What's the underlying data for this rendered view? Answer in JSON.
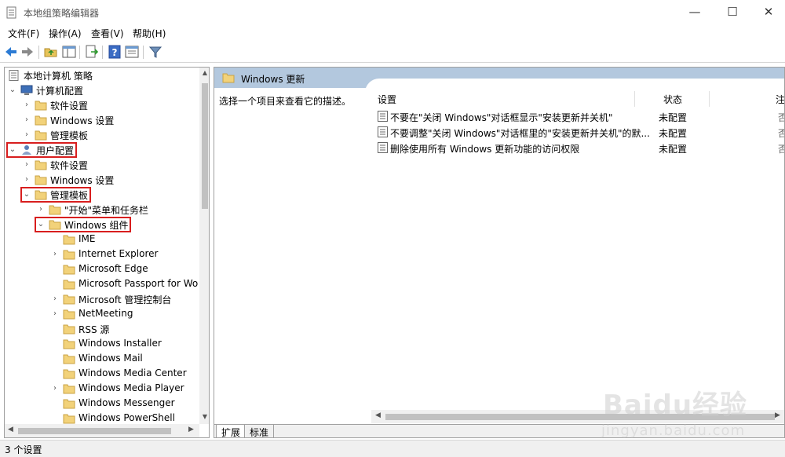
{
  "window": {
    "title": "本地组策略编辑器",
    "min_glyph": "—",
    "max_glyph": "☐",
    "close_glyph": "✕"
  },
  "menu": [
    {
      "label": "文件(F)"
    },
    {
      "label": "操作(A)"
    },
    {
      "label": "查看(V)"
    },
    {
      "label": "帮助(H)"
    }
  ],
  "toolbar": {
    "icons": [
      "back-arrow-icon",
      "forward-arrow-icon",
      "up-folder-icon",
      "show-hide-tree-icon",
      "export-list-icon",
      "help-icon",
      "properties-icon",
      "filter-icon"
    ]
  },
  "tree": {
    "items": [
      {
        "label": "本地计算机 策略",
        "expander": "",
        "icon": "policy-doc-icon"
      },
      {
        "label": "计算机配置",
        "expander": "⌄",
        "icon": "computer-icon"
      },
      {
        "label": "软件设置",
        "expander": "›",
        "icon": "folder-icon"
      },
      {
        "label": "Windows 设置",
        "expander": "›",
        "icon": "folder-icon"
      },
      {
        "label": "管理模板",
        "expander": "›",
        "icon": "folder-icon"
      },
      {
        "label": "用户配置",
        "expander": "⌄",
        "icon": "user-icon",
        "highlight": true
      },
      {
        "label": "软件设置",
        "expander": "›",
        "icon": "folder-icon"
      },
      {
        "label": "Windows 设置",
        "expander": "›",
        "icon": "folder-icon"
      },
      {
        "label": "管理模板",
        "expander": "⌄",
        "icon": "folder-icon",
        "highlight": true
      },
      {
        "label": "\"开始\"菜单和任务栏",
        "expander": "›",
        "icon": "folder-icon"
      },
      {
        "label": "Windows 组件",
        "expander": "⌄",
        "icon": "folder-icon",
        "highlight": true
      },
      {
        "label": "IME",
        "expander": "",
        "icon": "folder-icon"
      },
      {
        "label": "Internet Explorer",
        "expander": "›",
        "icon": "folder-icon"
      },
      {
        "label": "Microsoft Edge",
        "expander": "",
        "icon": "folder-icon"
      },
      {
        "label": "Microsoft Passport for Wo",
        "expander": "",
        "icon": "folder-icon"
      },
      {
        "label": "Microsoft 管理控制台",
        "expander": "›",
        "icon": "folder-icon"
      },
      {
        "label": "NetMeeting",
        "expander": "›",
        "icon": "folder-icon"
      },
      {
        "label": "RSS 源",
        "expander": "",
        "icon": "folder-icon"
      },
      {
        "label": "Windows Installer",
        "expander": "",
        "icon": "folder-icon"
      },
      {
        "label": "Windows Mail",
        "expander": "",
        "icon": "folder-icon"
      },
      {
        "label": "Windows Media Center",
        "expander": "",
        "icon": "folder-icon"
      },
      {
        "label": "Windows Media Player",
        "expander": "›",
        "icon": "folder-icon"
      },
      {
        "label": "Windows Messenger",
        "expander": "",
        "icon": "folder-icon"
      },
      {
        "label": "Windows PowerShell",
        "expander": "",
        "icon": "folder-icon"
      }
    ]
  },
  "right": {
    "header": "Windows 更新",
    "description": "选择一个项目来查看它的描述。",
    "columns": {
      "setting": "设置",
      "state": "状态",
      "note": "注"
    },
    "rows": [
      {
        "name": "不要在\"关闭 Windows\"对话框显示\"安装更新并关机\"",
        "state": "未配置",
        "note": "否"
      },
      {
        "name": "不要调整\"关闭 Windows\"对话框里的\"安装更新并关机\"的默...",
        "state": "未配置",
        "note": "否"
      },
      {
        "name": "删除使用所有 Windows 更新功能的访问权限",
        "state": "未配置",
        "note": "否"
      }
    ],
    "tabs": [
      {
        "label": "扩展",
        "active": true
      },
      {
        "label": "标准",
        "active": false
      }
    ]
  },
  "status": {
    "text": "3 个设置"
  },
  "watermark": {
    "logo": "Baidu经验",
    "url": "jingyan.baidu.com"
  }
}
